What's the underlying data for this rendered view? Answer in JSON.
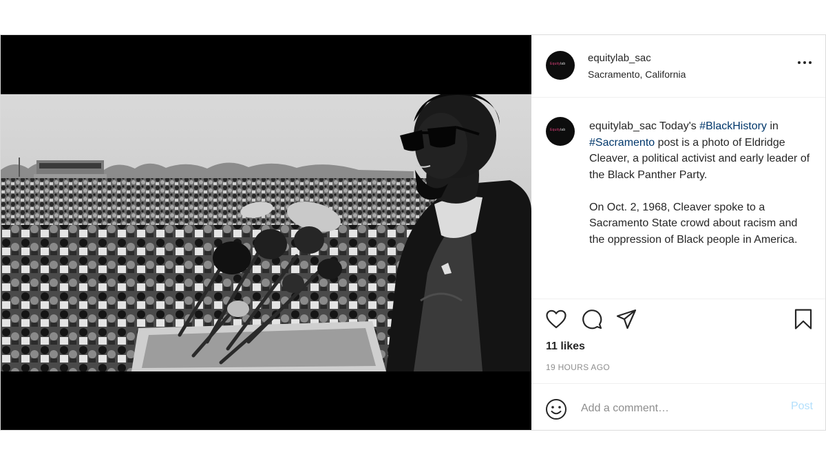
{
  "post": {
    "username": "equitylab_sac",
    "location": "Sacramento, California",
    "avatar_logo": {
      "prefix": "Equity",
      "suffix": "lab"
    },
    "caption": {
      "username": "equitylab_sac",
      "line1_before": " Today's ",
      "hashtag1": "#BlackHistory",
      "line1_mid": " in ",
      "hashtag2": "#Sacramento",
      "line1_after": " post is a photo of Eldridge Cleaver, a political activist and early leader of the Black Panther Party.",
      "paragraph2": "On Oct. 2, 1968, Cleaver spoke to a Sacramento State crowd about racism and the oppression of Black people in America."
    },
    "likes": "11 likes",
    "time": "19 HOURS AGO",
    "comment_placeholder": "Add a comment…",
    "post_button": "Post"
  },
  "icons": {
    "more": "more-options-icon",
    "like": "heart-icon",
    "comment": "comment-bubble-icon",
    "share": "paper-plane-icon",
    "save": "bookmark-icon",
    "emoji": "emoji-smile-icon"
  },
  "colors": {
    "hashtag": "#00376b",
    "post_button": "#b2dffc",
    "muted": "#8e8e8e",
    "media_background": "#000000"
  }
}
